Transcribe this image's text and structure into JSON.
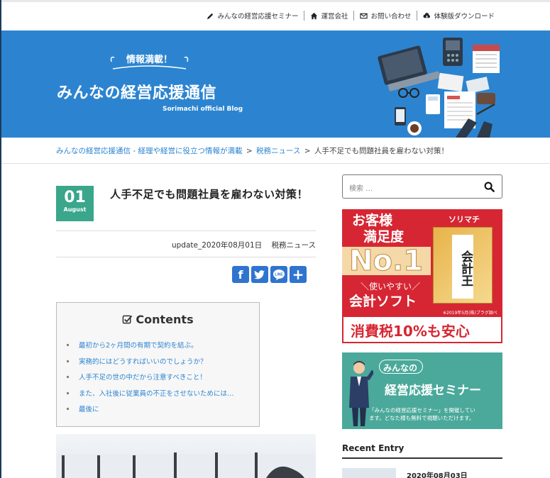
{
  "topnav": {
    "items": [
      {
        "label": "みんなの経営応援セミナー",
        "icon": "pencil-icon"
      },
      {
        "label": "運営会社",
        "icon": "home-icon"
      },
      {
        "label": "お問い合わせ",
        "icon": "mail-icon"
      },
      {
        "label": "体験版ダウンロード",
        "icon": "cloud-download-icon"
      }
    ]
  },
  "header": {
    "tagline": "情報満載！",
    "title": "みんなの経営応援通信",
    "subtitle": "Sorimachi official Blog",
    "color": "#2c84d0"
  },
  "breadcrumb": {
    "home": "みんなの経営応援通信 - 経理や経営に役立つ情報が満載",
    "category": "税務ニュース",
    "current": "人手不足でも問題社員を雇わない対策！",
    "sep": ">"
  },
  "post": {
    "day": "01",
    "month": "August",
    "title": "人手不足でも問題社員を雇わない対策！",
    "update": "update_2020年08月01日",
    "category": "税務ニュース",
    "accent": "#3aa68c"
  },
  "share": {
    "icons": [
      "facebook-icon",
      "twitter-icon",
      "line-icon",
      "add-icon"
    ],
    "facebook": "f",
    "line": "LINE",
    "add": "+"
  },
  "toc": {
    "title": "Contents",
    "items": [
      "最初から2ヶ月間の有期で契約を結ぶ。",
      "実務的にはどうすればいいのでしょうか？",
      "人手不足の世の中だから注意すべきこと！",
      "また、入社後に従業員の不正をさせないためには…",
      "最後に"
    ]
  },
  "sidebar": {
    "search_placeholder": "検索 …",
    "ad1": {
      "line1": "お客様",
      "line2": "満足度",
      "big": "No.1",
      "line3": "＼使いやすい／",
      "line4": "会計ソフト",
      "brand": "ソリマチ",
      "product": "会計王",
      "note": "※2019年5月(株)ブラグ調べ",
      "bottom": "消費税10%も安心",
      "color": "#d62633"
    },
    "ad2": {
      "bubble": "みんなの",
      "title": "経営応援セミナー",
      "desc1": "「みんなの経営応援セミナー」を開催してい",
      "desc2": "ます。どなた様も無料で視聴いただけます。",
      "color": "#4aa99a"
    },
    "recent_heading": "Recent Entry",
    "recent_first_date": "2020年08月03日"
  }
}
